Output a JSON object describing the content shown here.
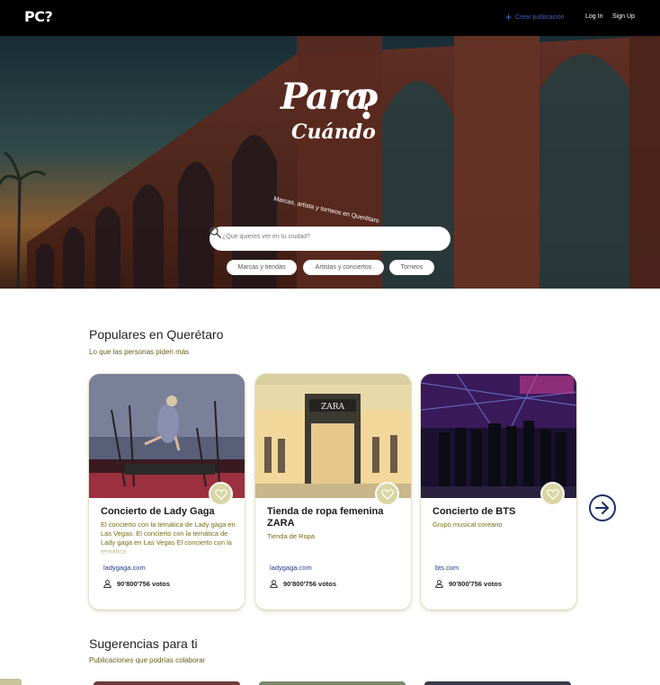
{
  "header": {
    "logo": "PC?",
    "create_label": "Crear publicación",
    "login_label": "Log In",
    "signup_label": "Sign Up"
  },
  "hero": {
    "brand_line1": "Para",
    "brand_q": "?",
    "brand_line2": "Cuándo",
    "tagline": "Marcas, artista y torneos en Querétaro",
    "search_placeholder": "¿Qué quieres ver en tu ciudad?",
    "chips": [
      "Marcas y tiendas",
      "Artistas y conciertos",
      "Torneos"
    ]
  },
  "popular": {
    "title": "Populares en Querétaro",
    "subtitle": "Lo que las personas piden más",
    "cards": [
      {
        "title": "Concierto de Lady Gaga",
        "description": "El concierto con la temática de Lady gaga en Las Vegas. El concierto con la temática de Lady gaga en Las Vegas El concierto con la temática.",
        "link": "ladygaga.com",
        "votes": "90'800'756 votos"
      },
      {
        "title": "Tienda de ropa femenina ZARA",
        "description": "Tienda de Ropa",
        "link": "ladygaga.com",
        "votes": "90'800'756 votos"
      },
      {
        "title": "Concierto de BTS",
        "description": "Grupo musical coreano",
        "link": "bts.com",
        "votes": "90'800'756 votos"
      }
    ]
  },
  "suggestions": {
    "title": "Sugerencias para ti",
    "subtitle": "Publicaciones que podrías colaborar"
  },
  "icons": {
    "create": "plus-icon",
    "search": "search-icon",
    "favorite": "heart-icon",
    "votes": "user-icon",
    "next": "arrow-right-circle-icon"
  },
  "colors": {
    "topbar": "#000000",
    "accent_blue": "#1d3e8a",
    "accent_olive": "#7b6a12",
    "heart_bg": "#d9d6a4"
  }
}
